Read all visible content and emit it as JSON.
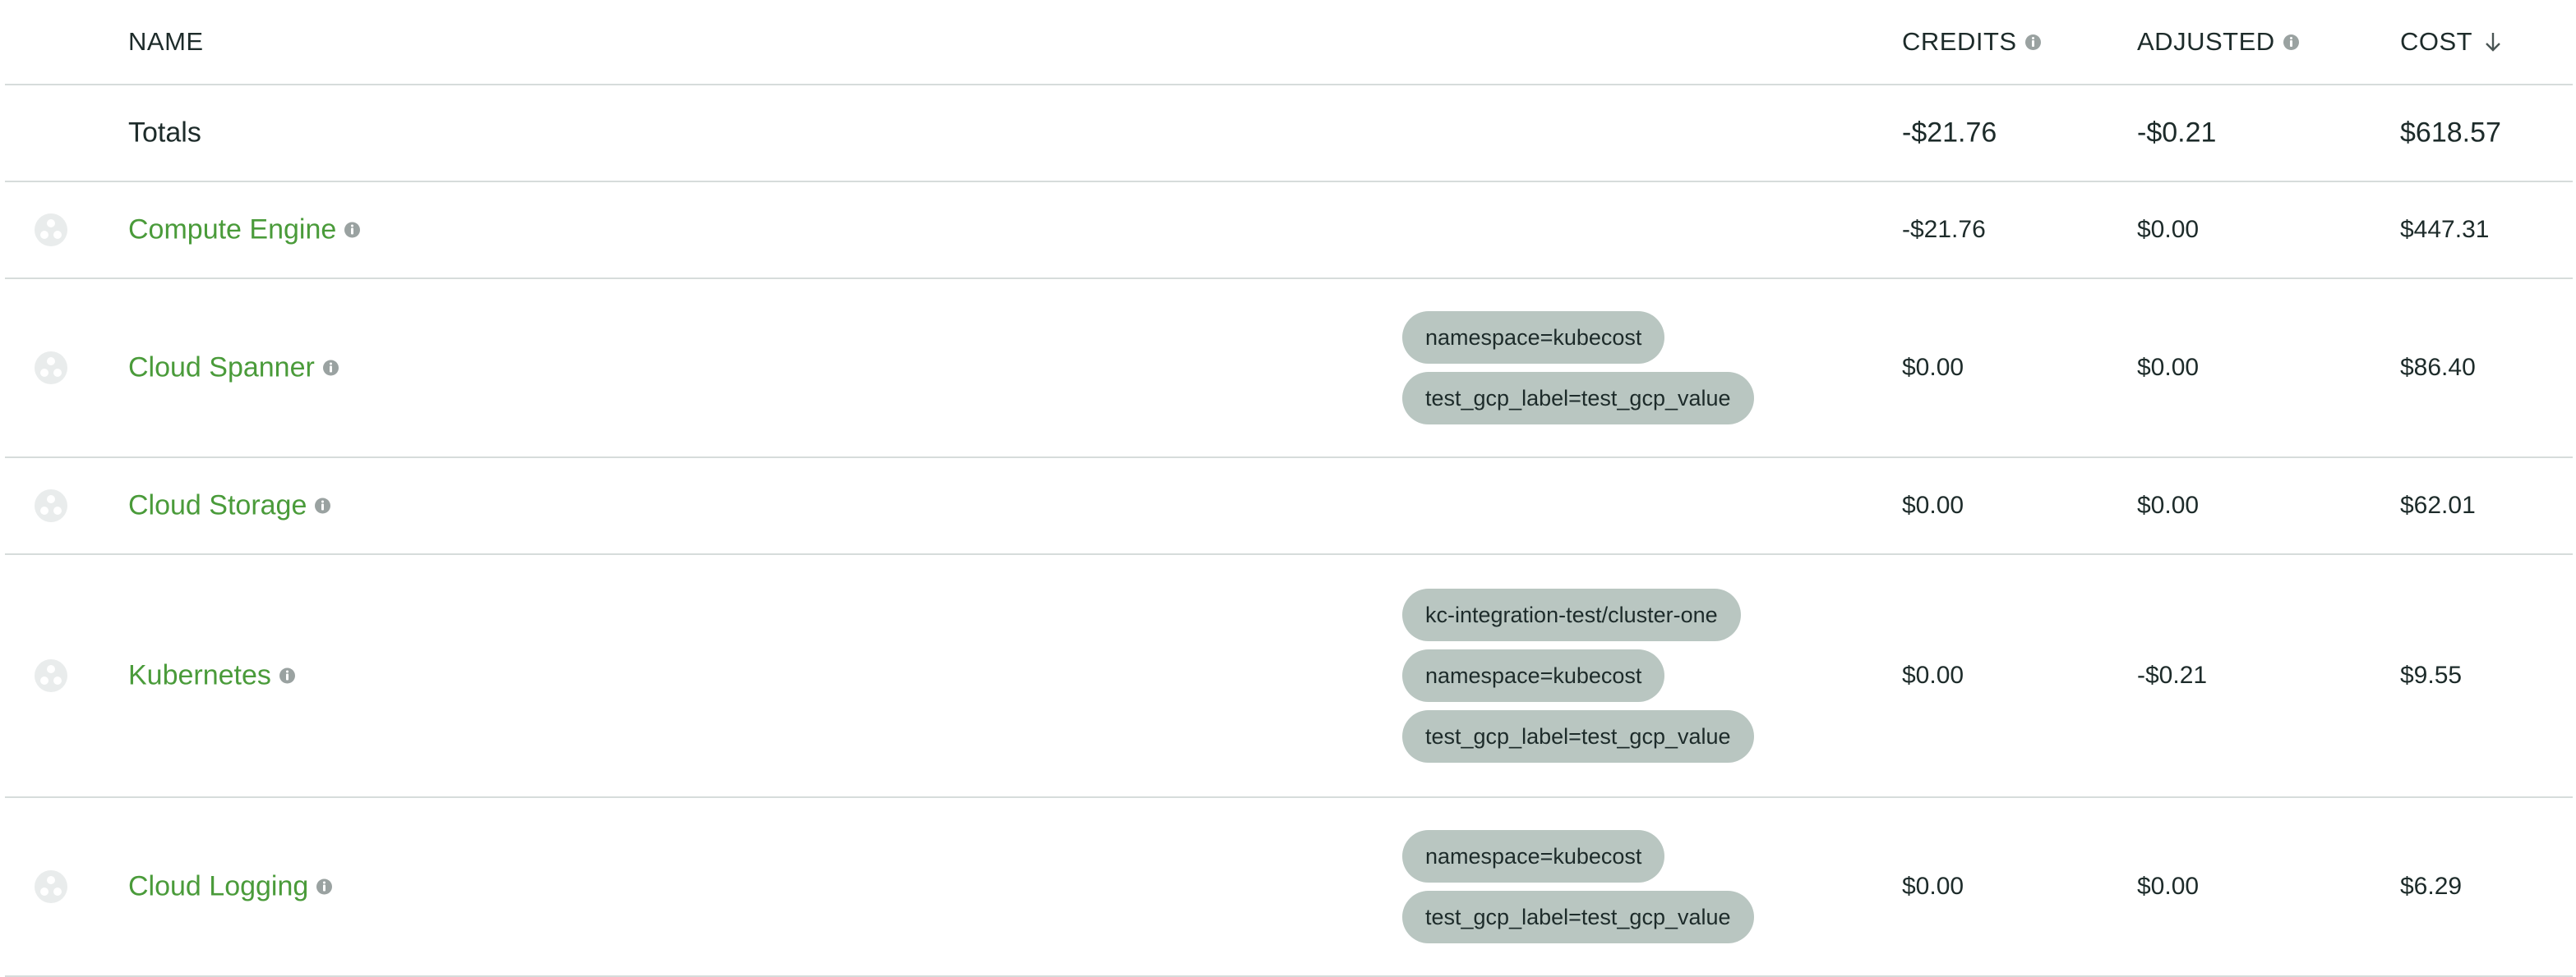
{
  "header": {
    "name": "NAME",
    "credits": "CREDITS",
    "adjusted": "ADJUSTED",
    "cost": "COST"
  },
  "totals": {
    "label": "Totals",
    "credits": "-$21.76",
    "adjusted": "-$0.21",
    "cost": "$618.57"
  },
  "rows": [
    {
      "name": "Compute Engine",
      "labels": [],
      "credits": "-$21.76",
      "adjusted": "$0.00",
      "cost": "$447.31"
    },
    {
      "name": "Cloud Spanner",
      "labels": [
        "namespace=kubecost",
        "test_gcp_label=test_gcp_value"
      ],
      "credits": "$0.00",
      "adjusted": "$0.00",
      "cost": "$86.40"
    },
    {
      "name": "Cloud Storage",
      "labels": [],
      "credits": "$0.00",
      "adjusted": "$0.00",
      "cost": "$62.01"
    },
    {
      "name": "Kubernetes",
      "labels": [
        "kc-integration-test/cluster-one",
        "namespace=kubecost",
        "test_gcp_label=test_gcp_value"
      ],
      "credits": "$0.00",
      "adjusted": "-$0.21",
      "cost": "$9.55"
    },
    {
      "name": "Cloud Logging",
      "labels": [
        "namespace=kubecost",
        "test_gcp_label=test_gcp_value"
      ],
      "credits": "$0.00",
      "adjusted": "$0.00",
      "cost": "$6.29"
    }
  ],
  "colors": {
    "service_name": "#4a9b3a",
    "pill_bg": "#b9c6c1",
    "divider": "#d6dcdb",
    "text": "#1d2b2a",
    "info_icon": "#9aa2a1"
  },
  "icons": {
    "info": "info-icon",
    "sort": "arrow-down-icon",
    "service": "service-icon"
  }
}
